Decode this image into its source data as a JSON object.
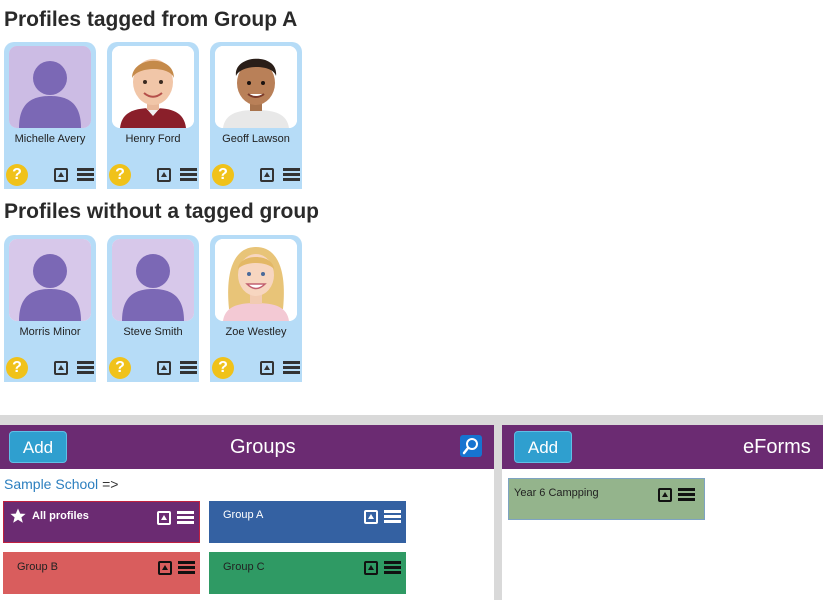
{
  "sections": {
    "tagged_title": "Profiles tagged from Group A",
    "untagged_title": "Profiles without a tagged group"
  },
  "tagged_profiles": [
    {
      "name": "Michelle Avery",
      "photo": "silhouette-placeholder"
    },
    {
      "name": "Henry Ford",
      "photo": "boy-portrait"
    },
    {
      "name": "Geoff Lawson",
      "photo": "boy-portrait-dark-hair"
    }
  ],
  "untagged_profiles": [
    {
      "name": "Morris Minor",
      "photo": "silhouette-placeholder"
    },
    {
      "name": "Steve Smith",
      "photo": "silhouette-placeholder"
    },
    {
      "name": "Zoe Westley",
      "photo": "girl-portrait"
    }
  ],
  "card_icons": {
    "help": "?",
    "expand": "expand-icon",
    "menu": "menu-icon"
  },
  "groups_panel": {
    "add_label": "Add",
    "title": "Groups",
    "search_icon": "search-icon",
    "breadcrumb_link": "Sample School",
    "breadcrumb_arrow": "=>",
    "tiles": [
      {
        "label": "All profiles",
        "color": "#6b2b72",
        "icon": "star-icon"
      },
      {
        "label": "Group A",
        "color": "#3461a2"
      },
      {
        "label": "Group B",
        "color": "#d95d5d"
      },
      {
        "label": "Group C",
        "color": "#2f9a64"
      }
    ]
  },
  "eforms_panel": {
    "add_label": "Add",
    "title": "eForms",
    "tiles": [
      {
        "label": "Year 6 Campping",
        "color": "#94b48c"
      }
    ]
  },
  "colors": {
    "header": "#6b2b72",
    "add_button": "#2f9fcf",
    "card_bg": "#b6dcf7",
    "help_icon": "#f0c21a",
    "link": "#2c7fbf"
  }
}
